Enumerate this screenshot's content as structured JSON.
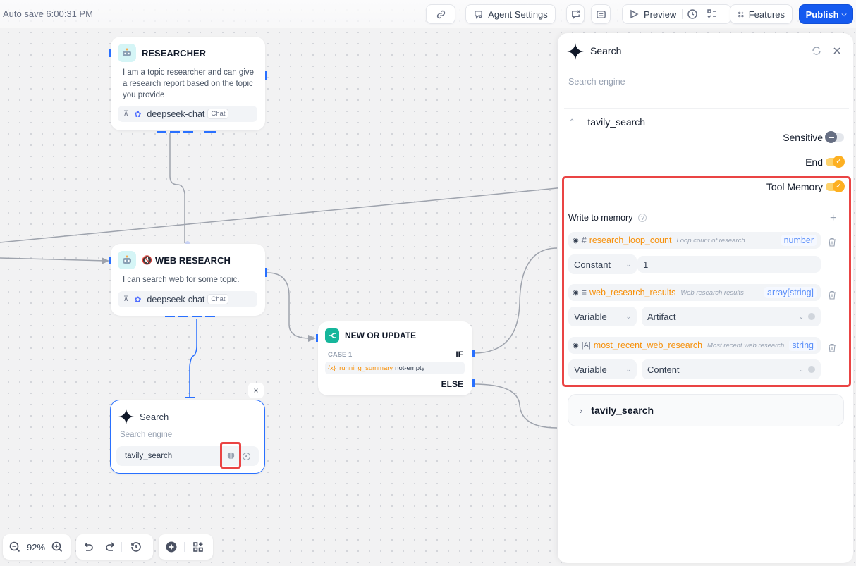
{
  "header": {
    "autosave": "Auto save 6:00:31 PM",
    "agent_settings": "Agent Settings",
    "preview": "Preview",
    "features": "Features",
    "publish": "Publish"
  },
  "nodes": {
    "researcher": {
      "title": "RESEARCHER",
      "description": "I am a topic researcher and can give a research report based on the topic you provide",
      "model": "deepseek-chat",
      "model_tag": "Chat"
    },
    "web_research": {
      "title": "WEB RESEARCH",
      "description": "I can search web for some topic.",
      "model": "deepseek-chat",
      "model_tag": "Chat"
    },
    "new_or_update": {
      "title": "NEW OR UPDATE",
      "case_label": "CASE 1",
      "if_label": "IF",
      "else_label": "ELSE",
      "condition_var_icon": "{x}",
      "condition_var": "running_summary",
      "condition_op": "not-empty"
    },
    "search": {
      "title": "Search",
      "description": "Search engine",
      "tool": "tavily_search",
      "close": "×"
    }
  },
  "zoom_controls": {
    "zoom_level": "92%"
  },
  "panel": {
    "title": "Search",
    "description": "Search engine",
    "tool_section": {
      "name": "tavily_search",
      "expanded": true,
      "sensitive_label": "Sensitive",
      "sensitive_on": false,
      "end_label": "End",
      "end_on": true,
      "tool_memory_label": "Tool Memory",
      "tool_memory_on": true,
      "write_to_memory_label": "Write to memory",
      "variables": [
        {
          "type_glyph": "#",
          "name": "research_loop_count",
          "description": "Loop count of research",
          "type": "number",
          "mode": "Constant",
          "value": "1"
        },
        {
          "type_glyph": "≡",
          "name": "web_research_results",
          "description": "Web research results",
          "type": "array[string]",
          "mode": "Variable",
          "value": "Artifact"
        },
        {
          "type_glyph": "|A|",
          "name": "most_recent_web_research",
          "description": "Most recent web research...",
          "type": "string",
          "mode": "Variable",
          "value": "Content"
        }
      ]
    },
    "collapsed_section": {
      "name": "tavily_search"
    }
  },
  "colors": {
    "accent": "#155aef",
    "handle": "#2970ff",
    "toggle_on": "#fdb022",
    "highlight": "#ea4444",
    "variable": "#f79009"
  }
}
